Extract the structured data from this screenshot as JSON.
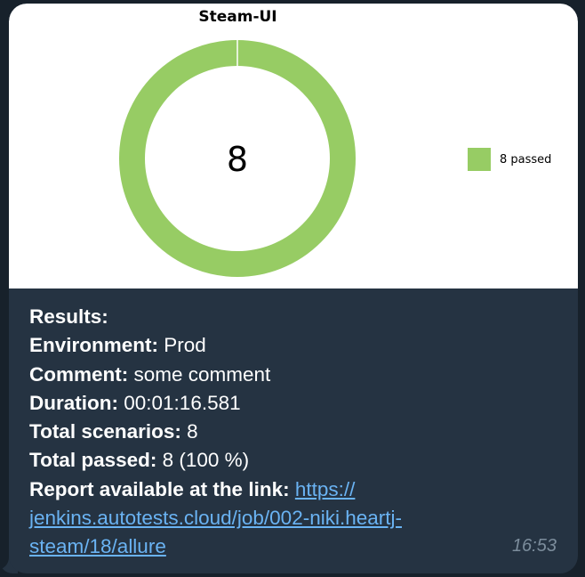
{
  "chart_data": {
    "type": "pie",
    "title": "Steam-UI",
    "center_label": "8",
    "slices": [
      {
        "name": "8 passed",
        "value": 8,
        "color": "#97cc64"
      }
    ],
    "legend": {
      "placement": "right",
      "entries": [
        "8 passed"
      ]
    }
  },
  "message": {
    "results_label": "Results:",
    "environment_label": "Environment:",
    "environment_value": " Prod",
    "comment_label": "Comment:",
    "comment_value": " some comment",
    "duration_label": "Duration:",
    "duration_value": " 00:01:16.581",
    "total_scenarios_label": "Total scenarios:",
    "total_scenarios_value": " 8",
    "total_passed_label": "Total passed:",
    "total_passed_value": " 8 (100 %)",
    "report_label": "Report available at the link:",
    "link_line1": "https://",
    "link_line2": "jenkins.autotests.cloud/job/002-niki.heartj-",
    "link_line3": "steam/18/allure",
    "time": "16:53"
  },
  "colors": {
    "background": "#17212b",
    "bubble": "#253342",
    "link": "#6ab3f3",
    "passed": "#97cc64"
  }
}
